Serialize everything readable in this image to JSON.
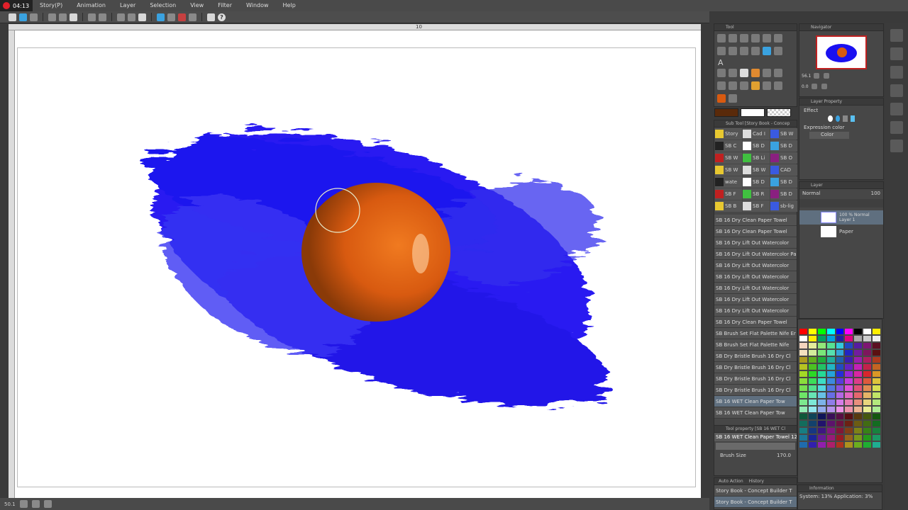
{
  "recorder": {
    "time": "04:13"
  },
  "menu": {
    "items": [
      "Story(P)",
      "Animation",
      "Layer",
      "Selection",
      "View",
      "Filter",
      "Window",
      "Help"
    ]
  },
  "ruler": {
    "mark": "10"
  },
  "canvas": {
    "zoom": "50.1"
  },
  "tool_panel": {
    "title": "Tool",
    "text_tool": "A"
  },
  "navigator": {
    "title": "Navigator",
    "zoom": "56.1",
    "angle": "0.0"
  },
  "layer_property": {
    "title": "Layer Property",
    "effect": "Effect",
    "expression_color": "Expression color",
    "color_value": "Color"
  },
  "sub_tool": {
    "title": "Sub Tool [Story Book - Concep",
    "grid": [
      "Story",
      "Cad I",
      "SB W",
      "SB C",
      "SB D",
      "SB D",
      "SB W",
      "SB Li",
      "SB O",
      "SB W",
      "SB W",
      "CAD",
      "wate",
      "SB D",
      "SB D",
      "SB F",
      "SB R",
      "SB D",
      "SB B",
      "SB F",
      "sb-lig"
    ],
    "list": [
      "SB 16 Dry Clean Paper Towel",
      "SB 16 Dry Clean Paper Towel",
      "SB 16 Dry Lift Out Watercolor",
      "SB 16 Dry Lift Out Watercolor Pa",
      "SB 16 Dry Lift Out Watercolor",
      "SB 16 Dry Lift Out Watercolor",
      "SB 16 Dry Lift Out Watercolor",
      "SB 16 Dry Lift Out Watercolor",
      "SB 16 Dry Lift Out Watercolor",
      "SB 16 Dry Clean Paper Towel",
      "SB Brush Set Flat Palette Nife Er",
      "SB Brush Set Flat Palette Nife",
      "SB Dry Bristle Brush 16 Dry Cl",
      "SB Dry Bristle Brush 16 Dry Cl",
      "SB Dry Bristle Brush 16 Dry Cl",
      "SB Dry Bristle Brush 16 Dry Cl",
      "SB 16 WET Clean Paper Tow",
      "SB 16 WET Clean Paper Tow"
    ]
  },
  "tool_property": {
    "title": "Tool property [SB 16 WET Cl",
    "brush_name": "SB 16 WET Clean Paper Towel 12",
    "brush_size_label": "Brush Size",
    "brush_size": "170.0"
  },
  "layer": {
    "title": "Layer",
    "blend": "Normal",
    "opacity": "100",
    "layers": [
      {
        "label": "100 % Normal",
        "name": "Layer 1"
      },
      {
        "label": "",
        "name": "Paper"
      }
    ]
  },
  "history": {
    "tabs": [
      "Auto Action",
      "History"
    ],
    "items": [
      "Story Book - Concept Builder T",
      "Story Book - Concept Builder T"
    ]
  },
  "information": {
    "title": "Information",
    "system": "System: 13% Application: 3%"
  },
  "colors": {
    "blue": "#1a10f0",
    "orange": "#d85a10",
    "accent": "#3aa2e0"
  }
}
